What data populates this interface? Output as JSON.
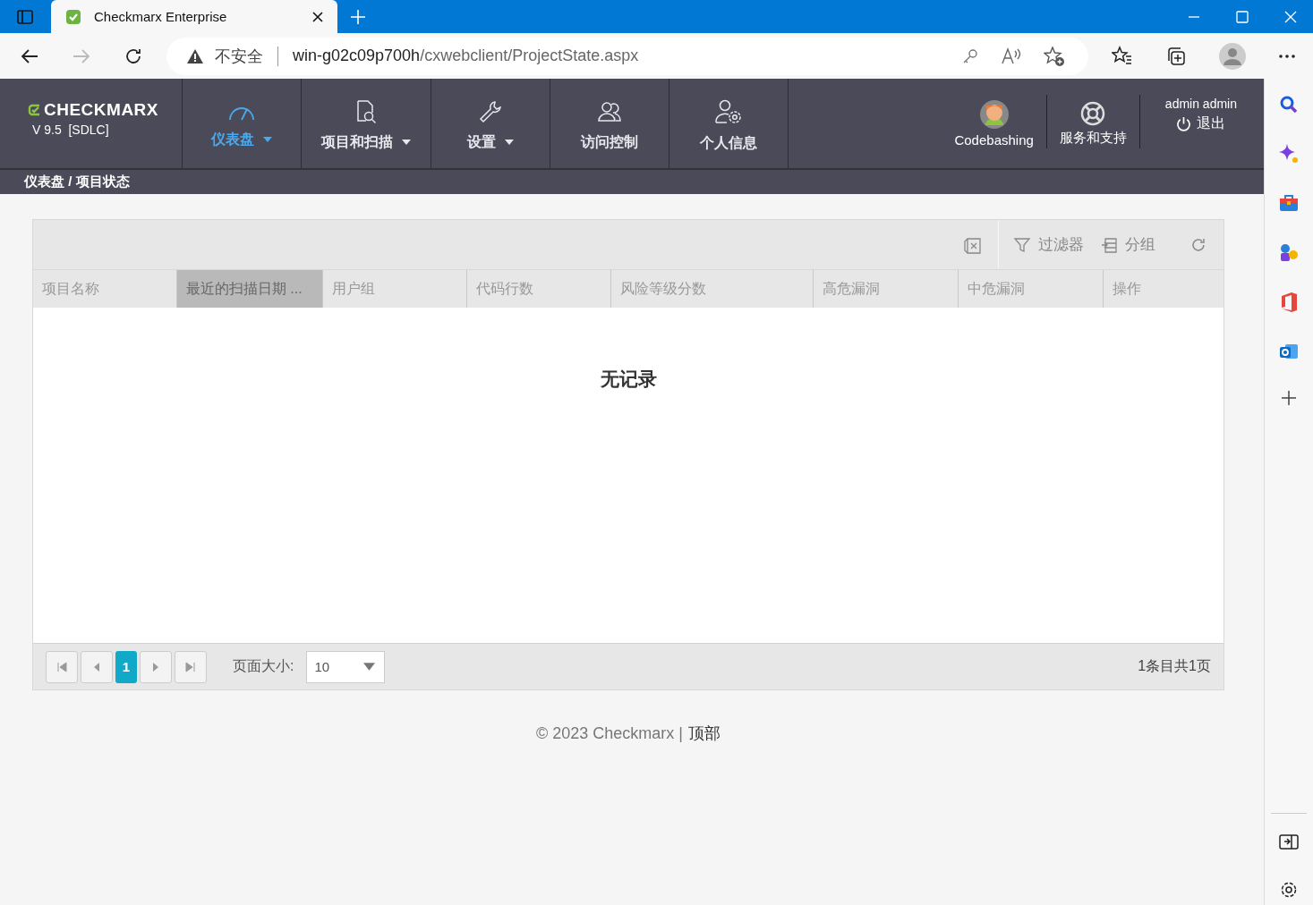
{
  "browser": {
    "tab_title": "Checkmarx Enterprise",
    "security": "不安全",
    "url_host": "win-g02c09p700h",
    "url_path": "/cxwebclient/ProjectState.aspx"
  },
  "header": {
    "logo": "CHECKMARX",
    "version": "V 9.5  [SDLC]",
    "nav": [
      {
        "label": "仪表盘",
        "dropdown": true,
        "selected": true,
        "kind": "gauge"
      },
      {
        "label": "项目和扫描",
        "dropdown": true,
        "selected": false,
        "kind": "scan"
      },
      {
        "label": "设置",
        "dropdown": true,
        "selected": false,
        "kind": "wrench"
      },
      {
        "label": "访问控制",
        "dropdown": false,
        "selected": false,
        "kind": "users"
      },
      {
        "label": "个人信息",
        "dropdown": false,
        "selected": false,
        "kind": "profile"
      }
    ],
    "codebashing": "Codebashing",
    "support": "服务和支持",
    "user": "admin admin",
    "logout": "退出"
  },
  "breadcrumb": "仪表盘 / 项目状态",
  "toolbar": {
    "filter": "过滤器",
    "group": "分组"
  },
  "table": {
    "columns": [
      {
        "label": "项目名称",
        "sorted": false
      },
      {
        "label": "最近的扫描日期 ...",
        "sorted": true
      },
      {
        "label": "用户组",
        "sorted": false
      },
      {
        "label": "代码行数",
        "sorted": false
      },
      {
        "label": "风险等级分数",
        "sorted": false
      },
      {
        "label": "高危漏洞",
        "sorted": false
      },
      {
        "label": "中危漏洞",
        "sorted": false
      },
      {
        "label": "操作",
        "sorted": false
      }
    ],
    "empty": "无记录"
  },
  "pager": {
    "pages": [
      {
        "label": "1",
        "selected": true
      }
    ],
    "page_size_label": "页面大小:",
    "page_size": "10",
    "summary": "1条目共1页"
  },
  "footer": {
    "copyright": "© 2023 Checkmarx |",
    "top_link": "顶部"
  }
}
